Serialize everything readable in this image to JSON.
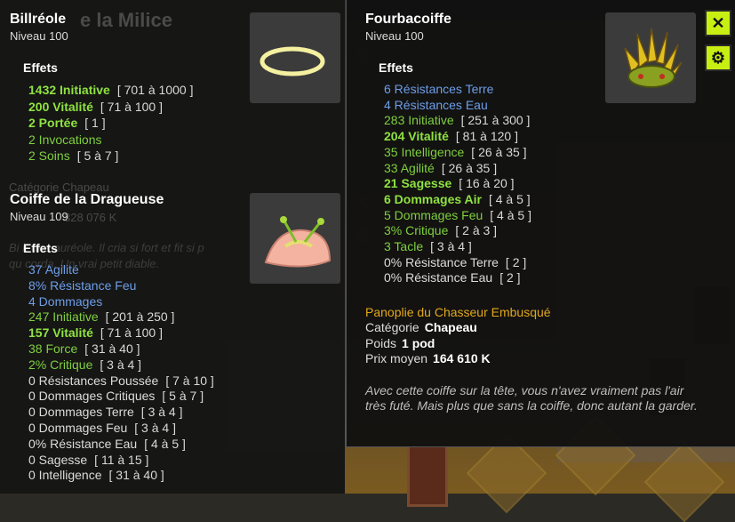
{
  "left_top": {
    "title": "Billréole",
    "level": "Niveau  100",
    "effects_label": "Effets",
    "effects": [
      {
        "value": "1432 Initiative",
        "range": "[ 701 à 1000 ]",
        "style": "bgreen"
      },
      {
        "value": "200 Vitalité",
        "range": "[ 71 à 100 ]",
        "style": "bgreen"
      },
      {
        "value": "2 Portée",
        "range": "[ 1 ]",
        "style": "bgreen"
      },
      {
        "value": "2 Invocations",
        "range": "",
        "style": "green"
      },
      {
        "value": "2 Soins",
        "range": "[ 5 à 7 ]",
        "style": "green"
      }
    ]
  },
  "left_bottom": {
    "title": "Coiffe de la Dragueuse",
    "level": "Niveau  109",
    "effects_label": "Effets",
    "effects": [
      {
        "value": "37 Agilité",
        "range": "",
        "style": "blue"
      },
      {
        "value": "8% Résistance Feu",
        "range": "",
        "style": "blue"
      },
      {
        "value": "4 Dommages",
        "range": "",
        "style": "blue"
      },
      {
        "value": "247 Initiative",
        "range": "[ 201 à 250 ]",
        "style": "green"
      },
      {
        "value": "157 Vitalité",
        "range": "[ 71 à 100 ]",
        "style": "bgreen"
      },
      {
        "value": "38 Force",
        "range": "[ 31 à 40 ]",
        "style": "green"
      },
      {
        "value": "2% Critique",
        "range": "[ 3 à 4 ]",
        "style": "green"
      },
      {
        "value": "0 Résistances Poussée",
        "range": "[ 7 à 10 ]",
        "style": "white"
      },
      {
        "value": "0 Dommages Critiques",
        "range": "[ 5 à 7 ]",
        "style": "white"
      },
      {
        "value": "0 Dommages Terre",
        "range": "[ 3 à 4 ]",
        "style": "white"
      },
      {
        "value": "0 Dommages Feu",
        "range": "[ 3 à 4 ]",
        "style": "white"
      },
      {
        "value": "0% Résistance Eau",
        "range": "[ 4 à 5 ]",
        "style": "white"
      },
      {
        "value": "0 Sagesse",
        "range": "[ 11 à 15 ]",
        "style": "white"
      },
      {
        "value": "0 Intelligence",
        "range": "[ 31 à 40 ]",
        "style": "white"
      }
    ]
  },
  "right": {
    "title": "Fourbacoiffe",
    "level": "Niveau  100",
    "effects_label": "Effets",
    "effects": [
      {
        "value": "6 Résistances Terre",
        "range": "",
        "style": "blue"
      },
      {
        "value": "4 Résistances Eau",
        "range": "",
        "style": "blue"
      },
      {
        "value": "283 Initiative",
        "range": "[ 251 à 300 ]",
        "style": "green"
      },
      {
        "value": "204 Vitalité",
        "range": "[ 81 à 120 ]",
        "style": "bgreen"
      },
      {
        "value": "35 Intelligence",
        "range": "[ 26 à 35 ]",
        "style": "green"
      },
      {
        "value": "33 Agilité",
        "range": "[ 26 à 35 ]",
        "style": "green"
      },
      {
        "value": "21 Sagesse",
        "range": "[ 16 à 20 ]",
        "style": "bgreen"
      },
      {
        "value": "6 Dommages Air",
        "range": "[ 4 à 5 ]",
        "style": "bgreen"
      },
      {
        "value": "5 Dommages Feu",
        "range": "[ 4 à 5 ]",
        "style": "green"
      },
      {
        "value": "3% Critique",
        "range": "[ 2 à 3 ]",
        "style": "green"
      },
      {
        "value": "3 Tacle",
        "range": "[ 3 à 4 ]",
        "style": "green"
      },
      {
        "value": "0% Résistance Terre",
        "range": "[ 2 ]",
        "style": "white"
      },
      {
        "value": "0% Résistance Eau",
        "range": "[ 2 ]",
        "style": "white"
      }
    ],
    "set_name": "Panoplie du Chasseur Embusqué",
    "category_label": "Catégorie",
    "category_value": "Chapeau",
    "weight_label": "Poids",
    "weight_value": "1 pod",
    "price_label": "Prix moyen",
    "price_value": "164 610 K",
    "description": "Avec cette coiffe sur la tête, vous n'avez vraiment pas l'air très futé. Mais plus que sans la coiffe, donc autant la garder.",
    "close_icon": "close-icon",
    "settings_icon": "gear-icon"
  },
  "background_text": {
    "title_ghost": "e la Milice",
    "category_ghost": "Catégorie   Chapeau",
    "price_ghost": "328 076 K",
    "desc_ghost_1": "Bi          it une auréole. Il cria si fort et fit si p",
    "desc_ghost_2": "qu          corda. Un vrai petit diable."
  },
  "colors": {
    "accent_button": "#c8ef12",
    "set_name": "#e2a81c",
    "effect_blue": "#6e9ee8",
    "effect_green": "#7fcf3e"
  }
}
